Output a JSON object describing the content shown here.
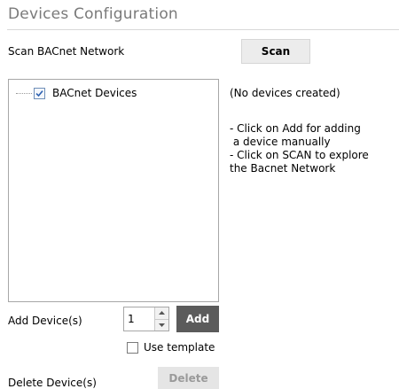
{
  "header": {
    "title": "Devices Configuration"
  },
  "scan": {
    "label": "Scan BACnet Network",
    "button_label": "Scan"
  },
  "tree": {
    "root_label": "BACnet Devices",
    "root_checked": true
  },
  "info": {
    "status": "(No devices created)",
    "hint_add_line1": "- Click on Add for adding",
    "hint_add_line2": " a device manually",
    "hint_scan_line1": "- Click on SCAN to explore",
    "hint_scan_line2": "the Bacnet Network"
  },
  "add": {
    "label": "Add Device(s)",
    "quantity": "1",
    "button_label": "Add",
    "use_template_label": "Use template",
    "use_template_checked": false
  },
  "delete": {
    "label": "Delete Device(s)",
    "button_label": "Delete"
  },
  "colors": {
    "title_gray": "#7a7a7a",
    "add_button_bg": "#5b5b5b",
    "disabled_button_bg": "#e5e5e5",
    "check_blue": "#2a5fb0"
  }
}
